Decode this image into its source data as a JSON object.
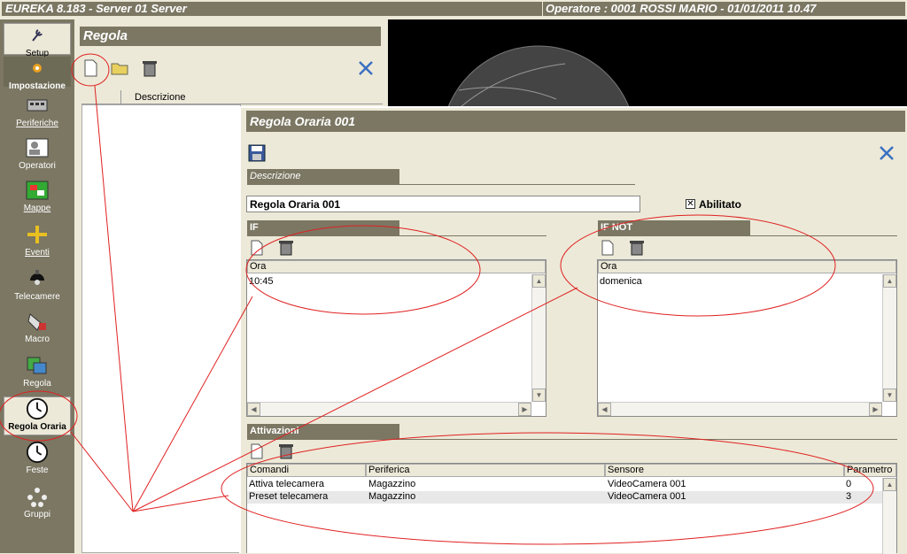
{
  "app": {
    "title": "EUREKA 8.183 - Server 01 Server",
    "operator": "Operatore : 0001 ROSSI MARIO - 01/01/2011 10.47"
  },
  "sidebar": {
    "items": [
      {
        "label": "Setup",
        "icon": "wrench-icon"
      },
      {
        "label": "Impostazione",
        "icon": "settings-icon"
      },
      {
        "label": "Periferiche",
        "icon": "device-icon"
      },
      {
        "label": "Operatori",
        "icon": "operators-icon"
      },
      {
        "label": "Mappe",
        "icon": "map-icon"
      },
      {
        "label": "Eventi",
        "icon": "events-icon"
      },
      {
        "label": "Telecamere",
        "icon": "camera-icon"
      },
      {
        "label": "Macro",
        "icon": "macro-icon"
      },
      {
        "label": "Regola",
        "icon": "rule-icon"
      },
      {
        "label": "Regola Oraria",
        "icon": "clock-icon"
      },
      {
        "label": "Feste",
        "icon": "clock-icon"
      },
      {
        "label": "Gruppi",
        "icon": "group-icon"
      }
    ]
  },
  "regola": {
    "title": "Regola",
    "column_description": "Descrizione"
  },
  "dialog": {
    "title": "Regola Oraria 001",
    "description_section": "Descrizione",
    "description_value": "Regola Oraria 001",
    "enabled_label": "Abilitato",
    "if_section": "IF",
    "if_column": "Ora",
    "if_rows": [
      "10:45"
    ],
    "ifnot_section": "IF NOT",
    "ifnot_column": "Ora",
    "ifnot_rows": [
      "domenica"
    ],
    "activations_section": "Attivazioni",
    "activations_columns": [
      "Comandi",
      "Periferica",
      "Sensore",
      "Parametro"
    ],
    "activations_rows": [
      [
        "Attiva telecamera",
        "Magazzino",
        "VideoCamera 001",
        "0"
      ],
      [
        "Preset telecamera",
        "Magazzino",
        "VideoCamera 001",
        "3"
      ]
    ]
  },
  "colors": {
    "chrome": "#ece9d8",
    "header": "#7b7763",
    "annotation": "#e02020"
  }
}
